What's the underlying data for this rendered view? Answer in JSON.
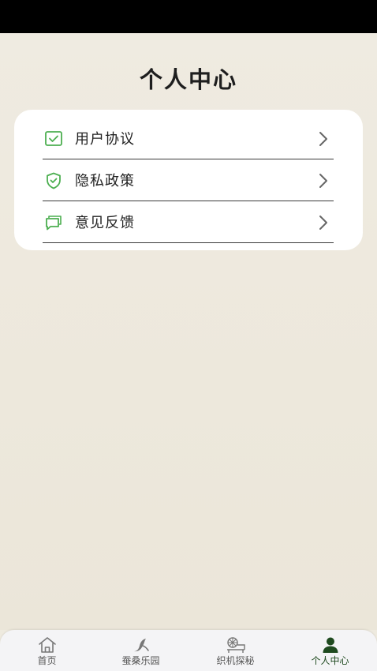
{
  "page": {
    "title": "个人中心"
  },
  "menu": {
    "items": [
      {
        "label": "用户协议",
        "icon": "document-check-icon"
      },
      {
        "label": "隐私政策",
        "icon": "shield-check-icon"
      },
      {
        "label": "意见反馈",
        "icon": "chat-bubble-icon"
      }
    ]
  },
  "tabbar": {
    "items": [
      {
        "label": "首页",
        "icon": "home-icon",
        "active": false
      },
      {
        "label": "蚕桑乐园",
        "icon": "silkworm-icon",
        "active": false
      },
      {
        "label": "织机探秘",
        "icon": "loom-icon",
        "active": false
      },
      {
        "label": "个人中心",
        "icon": "user-icon",
        "active": true
      }
    ]
  },
  "colors": {
    "accent": "#4caf50",
    "tab_active": "#1f4a1f",
    "background": "#eeeadf"
  }
}
